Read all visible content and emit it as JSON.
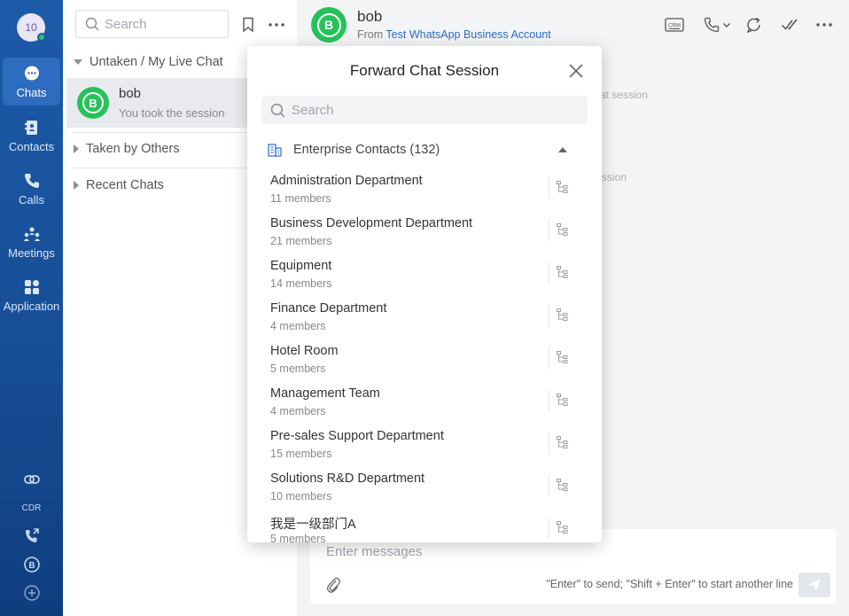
{
  "rail": {
    "avatar_text": "10",
    "items": [
      {
        "label": "Chats",
        "icon": "chat-bubble-icon"
      },
      {
        "label": "Contacts",
        "icon": "contacts-book-icon"
      },
      {
        "label": "Calls",
        "icon": "phone-icon"
      },
      {
        "label": "Meetings",
        "icon": "meetings-people-icon"
      },
      {
        "label": "Application",
        "icon": "app-grid-icon"
      }
    ],
    "bottom": {
      "cdr_label": "CDR"
    }
  },
  "list": {
    "search_placeholder": "Search",
    "sections": {
      "untaken": "Untaken / My Live Chat",
      "taken": "Taken by Others",
      "recent": "Recent Chats"
    },
    "chat": {
      "name": "bob",
      "status": "You took the session"
    }
  },
  "header": {
    "name": "bob",
    "from_prefix": "From",
    "account": "Test WhatsApp Business Account",
    "crm_label": "CRM"
  },
  "background_fragments": {
    "line1": "at session",
    "line2": "ssion"
  },
  "composer": {
    "placeholder": "Enter messages",
    "hint": "\"Enter\" to send; \"Shift + Enter\" to start another line"
  },
  "modal": {
    "title": "Forward Chat Session",
    "search_placeholder": "Search",
    "group_label": "Enterprise Contacts (132)",
    "departments": [
      {
        "name": "Administration Department",
        "members": "11 members"
      },
      {
        "name": "Business Development Department",
        "members": "21 members"
      },
      {
        "name": "Equipment",
        "members": "14 members"
      },
      {
        "name": "Finance Department",
        "members": "4 members"
      },
      {
        "name": "Hotel Room",
        "members": "5 members"
      },
      {
        "name": "Management Team",
        "members": "4 members"
      },
      {
        "name": "Pre-sales Support Department",
        "members": "15 members"
      },
      {
        "name": "Solutions R&D Department",
        "members": "10 members"
      },
      {
        "name": "我是一级部门A",
        "members": "5 members"
      }
    ]
  },
  "colors": {
    "rail": "#1d5aa8",
    "whatsapp": "#25c25a",
    "link": "#2d6cc4"
  }
}
